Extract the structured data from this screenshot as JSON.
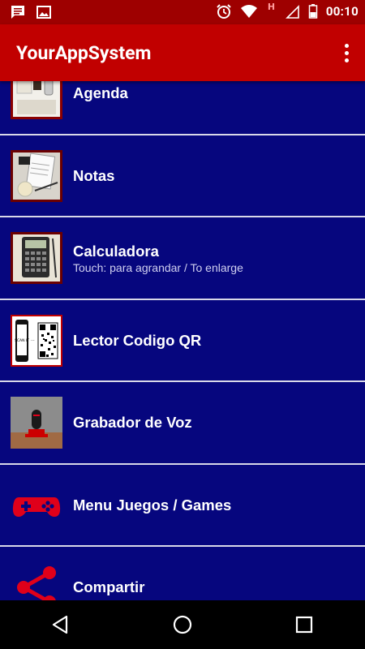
{
  "status_bar": {
    "time": "00:10",
    "left_icons": [
      "message-icon",
      "image-icon"
    ],
    "right_icons": [
      "alarm-icon",
      "wifi-icon",
      "h-signal-icon",
      "cell-signal-icon",
      "battery-icon"
    ],
    "network_label": "H"
  },
  "app_bar": {
    "title": "YourAppSystem",
    "menu_icon": "overflow-menu-icon"
  },
  "menu": {
    "items": [
      {
        "label": "Agenda",
        "sublabel": "",
        "icon": "agenda-thumbnail"
      },
      {
        "label": "Notas",
        "sublabel": "",
        "icon": "notes-thumbnail"
      },
      {
        "label": "Calculadora",
        "sublabel": "Touch: para agrandar / To enlarge",
        "icon": "calculator-thumbnail"
      },
      {
        "label": "Lector Codigo QR",
        "sublabel": "",
        "icon": "qr-phone-thumbnail"
      },
      {
        "label": "Grabador de Voz",
        "sublabel": "",
        "icon": "microphone-thumbnail"
      },
      {
        "label": "Menu Juegos / Games",
        "sublabel": "",
        "icon": "gamepad-icon"
      },
      {
        "label": "Compartir",
        "sublabel": "",
        "icon": "share-icon"
      }
    ]
  },
  "qr_thumb_text": "SCAN IT",
  "nav_bar": {
    "buttons": [
      "back-icon",
      "home-icon",
      "recents-icon"
    ]
  },
  "colors": {
    "status_bar": "#9e0000",
    "app_bar": "#c10000",
    "list_background": "#06067e",
    "divider": "#d8d8e8",
    "accent_red": "#e0001a"
  }
}
